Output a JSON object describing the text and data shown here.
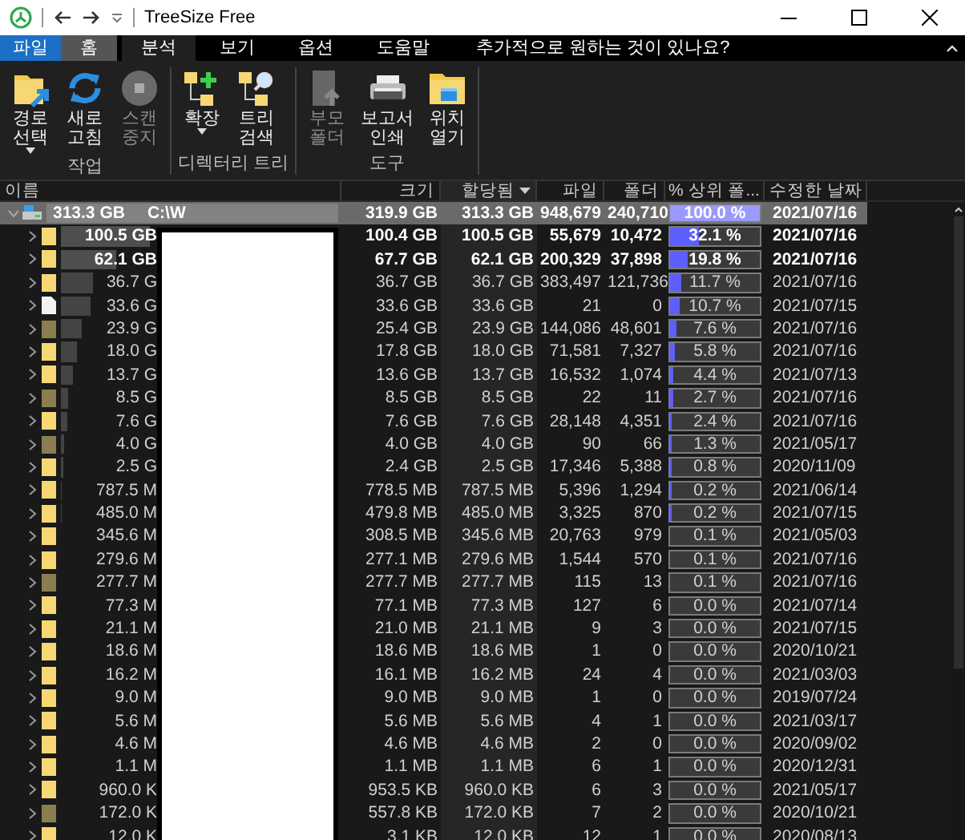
{
  "window": {
    "title": "TreeSize Free"
  },
  "menu": {
    "tabs": [
      {
        "label": "파일",
        "kind": "backstage",
        "selected": false,
        "highlighted": false
      },
      {
        "label": "홈",
        "kind": "tab",
        "selected": false,
        "highlighted": true
      },
      {
        "label": "분석",
        "kind": "tab",
        "selected": true,
        "highlighted": false
      },
      {
        "label": "보기",
        "kind": "tab",
        "selected": false,
        "highlighted": false
      },
      {
        "label": "옵션",
        "kind": "tab",
        "selected": false,
        "highlighted": false
      },
      {
        "label": "도움말",
        "kind": "tab",
        "selected": false,
        "highlighted": false
      }
    ],
    "tell_me": {
      "placeholder": "추가적으로 원하는 것이 있나요?"
    }
  },
  "ribbon": {
    "groups": [
      {
        "label": "작업",
        "buttons": [
          {
            "label": "경로\n선택",
            "dropdown": true,
            "disabled": false
          },
          {
            "label": "새로\n고침",
            "dropdown": false,
            "disabled": false
          },
          {
            "label": "스캔\n중지",
            "dropdown": false,
            "disabled": true
          }
        ]
      },
      {
        "label": "디렉터리 트리",
        "buttons": [
          {
            "label": "확장",
            "dropdown": true,
            "disabled": false
          },
          {
            "label": "트리\n검색",
            "dropdown": false,
            "disabled": false
          }
        ]
      },
      {
        "label": "도구",
        "buttons": [
          {
            "label": "부모\n폴더",
            "dropdown": false,
            "disabled": true
          },
          {
            "label": "보고서\n인쇄",
            "dropdown": false,
            "disabled": false
          },
          {
            "label": "위치\n열기",
            "dropdown": false,
            "disabled": false
          }
        ]
      }
    ]
  },
  "table": {
    "columns": [
      {
        "label": "이름",
        "sorted": false
      },
      {
        "label": "크기",
        "sorted": false
      },
      {
        "label": "할당됨",
        "sorted": true
      },
      {
        "label": "파일",
        "sorted": false
      },
      {
        "label": "폴더",
        "sorted": false
      },
      {
        "label": "% 상위 폴...",
        "sorted": false
      },
      {
        "label": "수정한 날짜",
        "sorted": false
      }
    ],
    "tree": {
      "name_size": "313.3 GB",
      "name": "C:\\W",
      "kind": "drive",
      "expanded": true,
      "selected": true,
      "bold": true,
      "size": "319.9 GB",
      "allocated": "313.3 GB",
      "files": "948,679",
      "folders": "240,710",
      "percent": "100.0 %",
      "level": 1.0,
      "date": "2021/07/16",
      "children": [
        {
          "name_size": "100.5 GB",
          "kind": "folder",
          "expanded": false,
          "selected": false,
          "bold": true,
          "size": "100.4 GB",
          "allocated": "100.5 GB",
          "files": "55,679",
          "folders": "10,472",
          "percent": "32.1 %",
          "level": 0.321,
          "date": "2021/07/16"
        },
        {
          "name_size": "62.1 GB",
          "kind": "folder",
          "expanded": false,
          "selected": false,
          "bold": true,
          "size": "67.7 GB",
          "allocated": "62.1 GB",
          "files": "200,329",
          "folders": "37,898",
          "percent": "19.8 %",
          "level": 0.198,
          "date": "2021/07/16"
        },
        {
          "name_size": "36.7 G",
          "kind": "folder",
          "expanded": false,
          "selected": false,
          "bold": false,
          "size": "36.7 GB",
          "allocated": "36.7 GB",
          "files": "383,497",
          "folders": "121,736",
          "percent": "11.7 %",
          "level": 0.117,
          "date": "2021/07/16"
        },
        {
          "name_size": "33.6 G",
          "kind": "file",
          "expanded": false,
          "selected": false,
          "bold": false,
          "size": "33.6 GB",
          "allocated": "33.6 GB",
          "files": "21",
          "folders": "0",
          "percent": "10.7 %",
          "level": 0.107,
          "date": "2021/07/15"
        },
        {
          "name_size": "23.9 G",
          "kind": "hidden-folder",
          "expanded": false,
          "selected": false,
          "bold": false,
          "size": "25.4 GB",
          "allocated": "23.9 GB",
          "files": "144,086",
          "folders": "48,601",
          "percent": "7.6 %",
          "level": 0.076,
          "date": "2021/07/16"
        },
        {
          "name_size": "18.0 G",
          "kind": "folder",
          "expanded": false,
          "selected": false,
          "bold": false,
          "size": "17.8 GB",
          "allocated": "18.0 GB",
          "files": "71,581",
          "folders": "7,327",
          "percent": "5.8 %",
          "level": 0.058,
          "date": "2021/07/16"
        },
        {
          "name_size": "13.7 G",
          "kind": "folder",
          "expanded": false,
          "selected": false,
          "bold": false,
          "size": "13.6 GB",
          "allocated": "13.7 GB",
          "files": "16,532",
          "folders": "1,074",
          "percent": "4.4 %",
          "level": 0.044,
          "date": "2021/07/13"
        },
        {
          "name_size": "8.5 G",
          "kind": "hidden-folder",
          "expanded": false,
          "selected": false,
          "bold": false,
          "size": "8.5 GB",
          "allocated": "8.5 GB",
          "files": "22",
          "folders": "11",
          "percent": "2.7 %",
          "level": 0.027,
          "date": "2021/07/16"
        },
        {
          "name_size": "7.6 G",
          "kind": "folder",
          "expanded": false,
          "selected": false,
          "bold": false,
          "size": "7.6 GB",
          "allocated": "7.6 GB",
          "files": "28,148",
          "folders": "4,351",
          "percent": "2.4 %",
          "level": 0.024,
          "date": "2021/07/16"
        },
        {
          "name_size": "4.0 G",
          "kind": "hidden-folder",
          "expanded": false,
          "selected": false,
          "bold": false,
          "size": "4.0 GB",
          "allocated": "4.0 GB",
          "files": "90",
          "folders": "66",
          "percent": "1.3 %",
          "level": 0.013,
          "date": "2021/05/17"
        },
        {
          "name_size": "2.5 G",
          "kind": "folder",
          "expanded": false,
          "selected": false,
          "bold": false,
          "size": "2.4 GB",
          "allocated": "2.5 GB",
          "files": "17,346",
          "folders": "5,388",
          "percent": "0.8 %",
          "level": 0.008,
          "date": "2020/11/09"
        },
        {
          "name_size": "787.5 M",
          "kind": "folder",
          "expanded": false,
          "selected": false,
          "bold": false,
          "size": "778.5 MB",
          "allocated": "787.5 MB",
          "files": "5,396",
          "folders": "1,294",
          "percent": "0.2 %",
          "level": 0.002,
          "date": "2021/06/14"
        },
        {
          "name_size": "485.0 M",
          "kind": "folder",
          "expanded": false,
          "selected": false,
          "bold": false,
          "size": "479.8 MB",
          "allocated": "485.0 MB",
          "files": "3,325",
          "folders": "870",
          "percent": "0.2 %",
          "level": 0.002,
          "date": "2021/07/15"
        },
        {
          "name_size": "345.6 M",
          "kind": "folder",
          "expanded": false,
          "selected": false,
          "bold": false,
          "size": "308.5 MB",
          "allocated": "345.6 MB",
          "files": "20,763",
          "folders": "979",
          "percent": "0.1 %",
          "level": 0.001,
          "date": "2021/05/03"
        },
        {
          "name_size": "279.6 M",
          "kind": "folder",
          "expanded": false,
          "selected": false,
          "bold": false,
          "size": "277.1 MB",
          "allocated": "279.6 MB",
          "files": "1,544",
          "folders": "570",
          "percent": "0.1 %",
          "level": 0.001,
          "date": "2021/07/16"
        },
        {
          "name_size": "277.7 M",
          "kind": "hidden-folder",
          "expanded": false,
          "selected": false,
          "bold": false,
          "size": "277.7 MB",
          "allocated": "277.7 MB",
          "files": "115",
          "folders": "13",
          "percent": "0.1 %",
          "level": 0.001,
          "date": "2021/07/16"
        },
        {
          "name_size": "77.3 M",
          "kind": "folder",
          "expanded": false,
          "selected": false,
          "bold": false,
          "size": "77.1 MB",
          "allocated": "77.3 MB",
          "files": "127",
          "folders": "6",
          "percent": "0.0 %",
          "level": 0,
          "date": "2021/07/14"
        },
        {
          "name_size": "21.1 M",
          "kind": "folder",
          "expanded": false,
          "selected": false,
          "bold": false,
          "size": "21.0 MB",
          "allocated": "21.1 MB",
          "files": "9",
          "folders": "3",
          "percent": "0.0 %",
          "level": 0,
          "date": "2021/07/15"
        },
        {
          "name_size": "18.6 M",
          "kind": "folder",
          "expanded": false,
          "selected": false,
          "bold": false,
          "size": "18.6 MB",
          "allocated": "18.6 MB",
          "files": "1",
          "folders": "0",
          "percent": "0.0 %",
          "level": 0,
          "date": "2020/10/21"
        },
        {
          "name_size": "16.2 M",
          "kind": "folder",
          "expanded": false,
          "selected": false,
          "bold": false,
          "size": "16.1 MB",
          "allocated": "16.2 MB",
          "files": "24",
          "folders": "4",
          "percent": "0.0 %",
          "level": 0,
          "date": "2021/03/03"
        },
        {
          "name_size": "9.0 M",
          "kind": "folder",
          "expanded": false,
          "selected": false,
          "bold": false,
          "size": "9.0 MB",
          "allocated": "9.0 MB",
          "files": "1",
          "folders": "0",
          "percent": "0.0 %",
          "level": 0,
          "date": "2019/07/24"
        },
        {
          "name_size": "5.6 M",
          "kind": "folder",
          "expanded": false,
          "selected": false,
          "bold": false,
          "size": "5.6 MB",
          "allocated": "5.6 MB",
          "files": "4",
          "folders": "1",
          "percent": "0.0 %",
          "level": 0,
          "date": "2021/03/17"
        },
        {
          "name_size": "4.6 M",
          "kind": "folder",
          "expanded": false,
          "selected": false,
          "bold": false,
          "size": "4.6 MB",
          "allocated": "4.6 MB",
          "files": "2",
          "folders": "0",
          "percent": "0.0 %",
          "level": 0,
          "date": "2020/09/02"
        },
        {
          "name_size": "1.1 M",
          "kind": "folder",
          "expanded": false,
          "selected": false,
          "bold": false,
          "size": "1.1 MB",
          "allocated": "1.1 MB",
          "files": "6",
          "folders": "1",
          "percent": "0.0 %",
          "level": 0,
          "date": "2020/12/31"
        },
        {
          "name_size": "960.0 K",
          "kind": "folder",
          "expanded": false,
          "selected": false,
          "bold": false,
          "size": "953.5 KB",
          "allocated": "960.0 KB",
          "files": "6",
          "folders": "3",
          "percent": "0.0 %",
          "level": 0,
          "date": "2021/05/17"
        },
        {
          "name_size": "172.0 K",
          "kind": "hidden-folder",
          "expanded": false,
          "selected": false,
          "bold": false,
          "size": "557.8 KB",
          "allocated": "172.0 KB",
          "files": "7",
          "folders": "2",
          "percent": "0.0 %",
          "level": 0,
          "date": "2020/10/21"
        },
        {
          "name_size": "12.0 K",
          "kind": "folder",
          "expanded": false,
          "selected": false,
          "bold": false,
          "size": "3.1 KB",
          "allocated": "12.0 KB",
          "files": "12",
          "folders": "1",
          "percent": "0.0 %",
          "level": 0,
          "date": "2020/08/13"
        }
      ]
    }
  }
}
